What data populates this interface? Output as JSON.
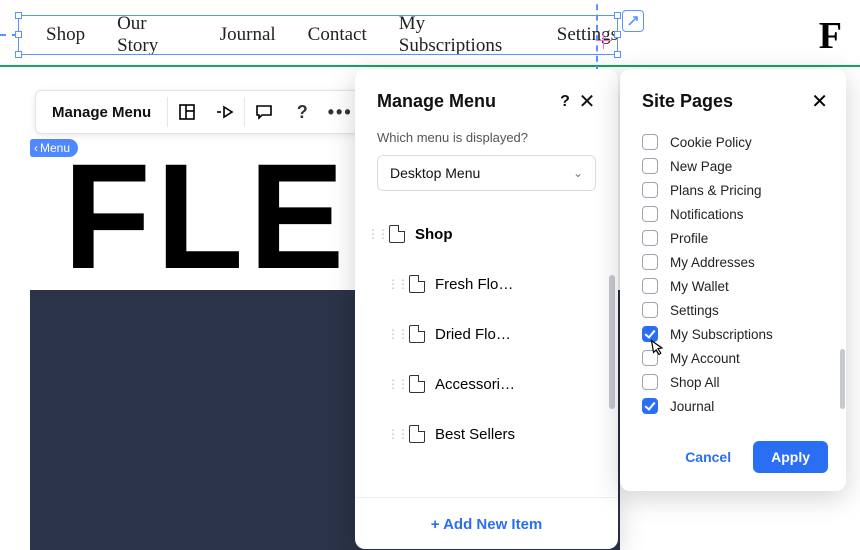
{
  "top_menu": {
    "items": [
      "Shop",
      "Our Story",
      "Journal",
      "Contact",
      "My Subscriptions",
      "Settings"
    ]
  },
  "logo": "F",
  "big_text": "FLE",
  "menu_chip": "Menu",
  "toolstrip": {
    "primary": "Manage Menu"
  },
  "manage_panel": {
    "title": "Manage Menu",
    "question_label": "Which menu is displayed?",
    "selected_menu": "Desktop Menu",
    "items": [
      {
        "label": "Shop",
        "child": false
      },
      {
        "label": "Fresh Flo…",
        "child": true
      },
      {
        "label": "Dried Flo…",
        "child": true
      },
      {
        "label": "Accessori…",
        "child": true
      },
      {
        "label": "Best Sellers",
        "child": true
      }
    ],
    "add_label": "+ Add New Item"
  },
  "pages_panel": {
    "title": "Site Pages",
    "options": [
      {
        "label": "Cookie Policy",
        "checked": false
      },
      {
        "label": "New Page",
        "checked": false
      },
      {
        "label": "Plans & Pricing",
        "checked": false
      },
      {
        "label": "Notifications",
        "checked": false
      },
      {
        "label": "Profile",
        "checked": false
      },
      {
        "label": "My Addresses",
        "checked": false
      },
      {
        "label": "My Wallet",
        "checked": false
      },
      {
        "label": "Settings",
        "checked": false
      },
      {
        "label": "My Subscriptions",
        "checked": true
      },
      {
        "label": "My Account",
        "checked": false
      },
      {
        "label": "Shop All",
        "checked": false
      },
      {
        "label": "Journal",
        "checked": true
      }
    ],
    "cancel": "Cancel",
    "apply": "Apply"
  }
}
